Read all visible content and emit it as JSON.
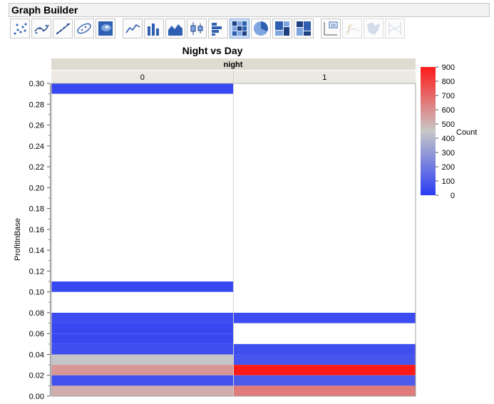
{
  "window": {
    "title": "Graph Builder"
  },
  "toolbar": {
    "buttons": [
      {
        "icon": "points-icon",
        "selected": false,
        "disabled": false
      },
      {
        "icon": "smoother-icon",
        "selected": false,
        "disabled": false
      },
      {
        "icon": "line-of-fit-icon",
        "selected": false,
        "disabled": false
      },
      {
        "icon": "ellipse-icon",
        "selected": false,
        "disabled": false
      },
      {
        "icon": "contour-icon",
        "selected": false,
        "disabled": false
      },
      {
        "icon": "line-icon",
        "selected": false,
        "disabled": false
      },
      {
        "icon": "bar-icon",
        "selected": false,
        "disabled": false
      },
      {
        "icon": "area-icon",
        "selected": false,
        "disabled": false
      },
      {
        "icon": "box-plot-icon",
        "selected": false,
        "disabled": false
      },
      {
        "icon": "histogram-icon",
        "selected": false,
        "disabled": false
      },
      {
        "icon": "heatmap-icon",
        "selected": true,
        "disabled": false
      },
      {
        "icon": "pie-icon",
        "selected": false,
        "disabled": false
      },
      {
        "icon": "treemap-icon",
        "selected": false,
        "disabled": false
      },
      {
        "icon": "mosaic-icon",
        "selected": false,
        "disabled": false
      },
      {
        "icon": "caption-box-icon",
        "selected": false,
        "disabled": false
      },
      {
        "icon": "formula-icon",
        "selected": false,
        "disabled": true
      },
      {
        "icon": "map-shapes-icon",
        "selected": false,
        "disabled": true
      },
      {
        "icon": "parallel-icon",
        "selected": false,
        "disabled": true
      }
    ]
  },
  "chart_data": {
    "type": "heatmap",
    "title": "Night vs Day",
    "group_label": "night",
    "categories": [
      "0",
      "1"
    ],
    "ylabel": "ProfitInBase",
    "ylim": [
      0,
      0.3
    ],
    "yticks": [
      "0.00",
      "0.02",
      "0.04",
      "0.06",
      "0.08",
      "0.10",
      "0.12",
      "0.14",
      "0.16",
      "0.18",
      "0.20",
      "0.22",
      "0.24",
      "0.26",
      "0.28",
      "0.30"
    ],
    "bin_width": 0.01,
    "grid": false,
    "cells": [
      {
        "category": "0",
        "bin_start": 0.29,
        "count": 40
      },
      {
        "category": "0",
        "bin_start": 0.1,
        "count": 40
      },
      {
        "category": "0",
        "bin_start": 0.07,
        "count": 50
      },
      {
        "category": "0",
        "bin_start": 0.06,
        "count": 40
      },
      {
        "category": "0",
        "bin_start": 0.05,
        "count": 40
      },
      {
        "category": "0",
        "bin_start": 0.04,
        "count": 60
      },
      {
        "category": "0",
        "bin_start": 0.03,
        "count": 440
      },
      {
        "category": "0",
        "bin_start": 0.02,
        "count": 580
      },
      {
        "category": "0",
        "bin_start": 0.01,
        "count": 70
      },
      {
        "category": "0",
        "bin_start": 0.0,
        "count": 520
      },
      {
        "category": "1",
        "bin_start": 0.07,
        "count": 50
      },
      {
        "category": "1",
        "bin_start": 0.04,
        "count": 60
      },
      {
        "category": "1",
        "bin_start": 0.03,
        "count": 80
      },
      {
        "category": "1",
        "bin_start": 0.02,
        "count": 900
      },
      {
        "category": "1",
        "bin_start": 0.01,
        "count": 100
      },
      {
        "category": "1",
        "bin_start": 0.0,
        "count": 650
      }
    ],
    "color_scale": {
      "label": "Count",
      "min": 0,
      "max": 900,
      "ticks": [
        "0",
        "100",
        "200",
        "300",
        "400",
        "500",
        "600",
        "700",
        "800",
        "900"
      ],
      "low_color": "#2a3cf5",
      "mid_color": "#c8c8c8",
      "high_color": "#ff1a1a",
      "placement": "right"
    },
    "colors": {
      "header_bg": "#dedbd0",
      "panel_border": "#a0a0a0",
      "divider": "#d0d0d0"
    }
  }
}
